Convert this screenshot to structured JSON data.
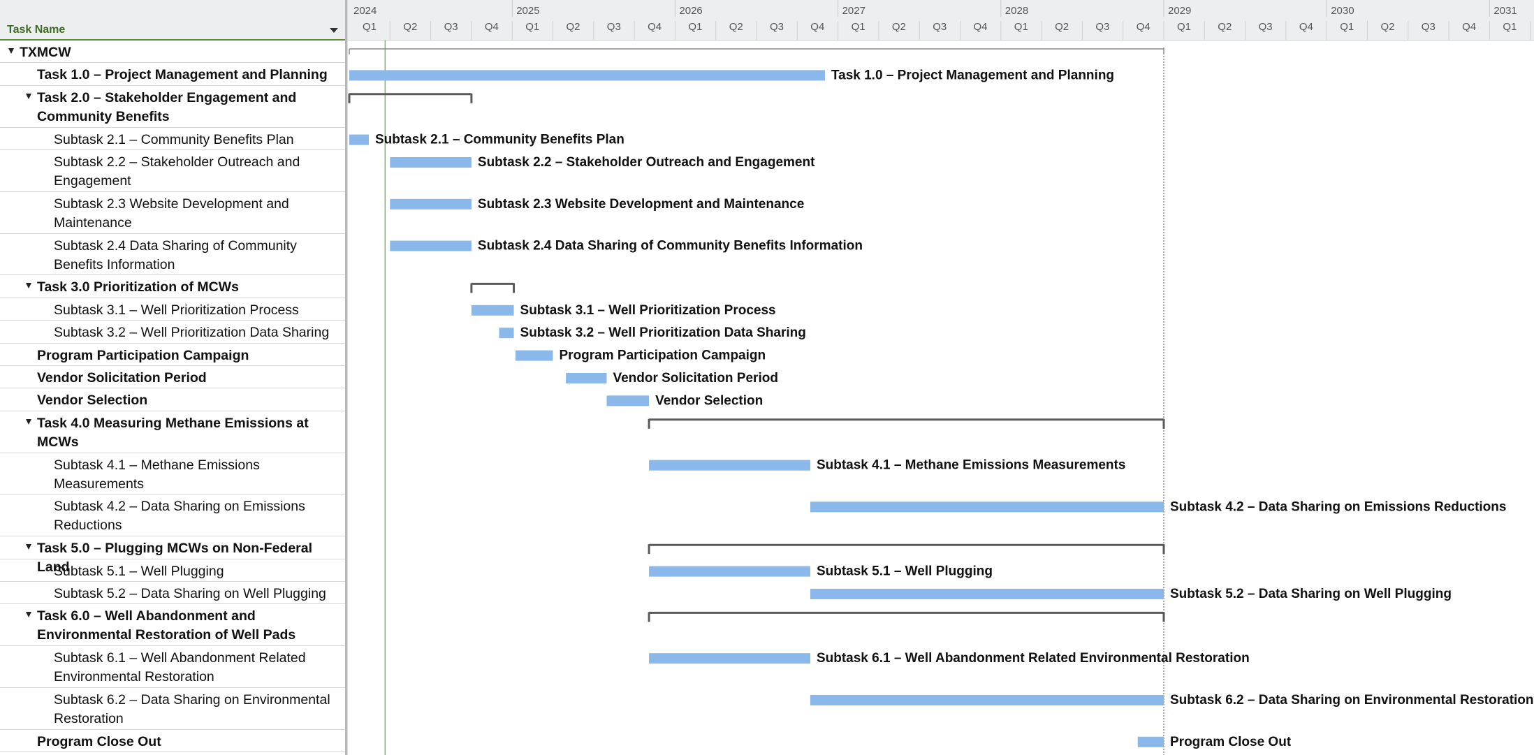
{
  "grid": {
    "header": "Task Name",
    "rows": [
      {
        "name": "TXMCW",
        "level": 0,
        "collapse": true,
        "lines": 1
      },
      {
        "name": "Task 1.0 – Project Management and Planning",
        "level": 1,
        "collapse": false,
        "lines": 1
      },
      {
        "name": "Task 2.0 – Stakeholder Engagement and Community Benefits",
        "level": 1,
        "collapse": true,
        "lines": 2,
        "line1": "Task 2.0 – Stakeholder Engagement and",
        "line2": "Community Benefits"
      },
      {
        "name": "Subtask 2.1 – Community Benefits Plan",
        "level": 2,
        "collapse": false,
        "lines": 1
      },
      {
        "name": "Subtask 2.2 – Stakeholder Outreach and Engagement",
        "level": 2,
        "collapse": false,
        "lines": 2,
        "line1": "Subtask 2.2 – Stakeholder Outreach and",
        "line2": "Engagement"
      },
      {
        "name": "Subtask 2.3 Website Development and Maintenance",
        "level": 2,
        "collapse": false,
        "lines": 2,
        "line1": "Subtask 2.3 Website Development and",
        "line2": "Maintenance"
      },
      {
        "name": "Subtask 2.4 Data Sharing of Community Benefits Information",
        "level": 2,
        "collapse": false,
        "lines": 2,
        "line1": "Subtask 2.4 Data Sharing of Community",
        "line2": "Benefits Information"
      },
      {
        "name": "Task 3.0 Prioritization of MCWs",
        "level": 1,
        "collapse": true,
        "lines": 1
      },
      {
        "name": "Subtask 3.1 – Well Prioritization Process",
        "level": 2,
        "collapse": false,
        "lines": 1
      },
      {
        "name": "Subtask 3.2 – Well Prioritization Data Sharing",
        "level": 2,
        "collapse": false,
        "lines": 1
      },
      {
        "name": "Program Participation Campaign",
        "level": 1,
        "collapse": false,
        "lines": 1
      },
      {
        "name": "Vendor Solicitation Period",
        "level": 1,
        "collapse": false,
        "lines": 1
      },
      {
        "name": "Vendor Selection",
        "level": 1,
        "collapse": false,
        "lines": 1
      },
      {
        "name": "Task 4.0 Measuring Methane Emissions at MCWs",
        "level": 1,
        "collapse": true,
        "lines": 2,
        "line1": "Task 4.0 Measuring Methane Emissions at",
        "line2": "MCWs"
      },
      {
        "name": "Subtask 4.1 – Methane Emissions Measurements",
        "level": 2,
        "collapse": false,
        "lines": 2,
        "line1": "Subtask 4.1 – Methane Emissions",
        "line2": "Measurements"
      },
      {
        "name": "Subtask 4.2 – Data Sharing on Emissions Reductions",
        "level": 2,
        "collapse": false,
        "lines": 2,
        "line1": "Subtask 4.2 – Data Sharing on Emissions",
        "line2": "Reductions"
      },
      {
        "name": "Task 5.0 – Plugging MCWs on Non-Federal Land",
        "level": 1,
        "collapse": true,
        "lines": 1
      },
      {
        "name": "Subtask 5.1 – Well Plugging",
        "level": 2,
        "collapse": false,
        "lines": 1
      },
      {
        "name": "Subtask 5.2 – Data Sharing on Well Plugging",
        "level": 2,
        "collapse": false,
        "lines": 1
      },
      {
        "name": "Task 6.0 – Well Abandonment and Environmental Restoration of Well Pads",
        "level": 1,
        "collapse": true,
        "lines": 2,
        "line1": "Task 6.0 – Well Abandonment and",
        "line2": "Environmental Restoration of Well Pads"
      },
      {
        "name": "Subtask 6.1 – Well Abandonment Related Environmental Restoration",
        "level": 2,
        "collapse": false,
        "lines": 2,
        "line1": "Subtask 6.1 – Well Abandonment Related",
        "line2": "Environmental Restoration"
      },
      {
        "name": "Subtask 6.2 – Data Sharing on Environmental Restoration",
        "level": 2,
        "collapse": false,
        "lines": 2,
        "line1": "Subtask 6.2 – Data Sharing on Environmental",
        "line2": "Restoration"
      },
      {
        "name": "Program Close Out",
        "level": 1,
        "collapse": false,
        "lines": 1
      }
    ]
  },
  "chart_data": {
    "type": "gantt",
    "timescale": {
      "years": [
        "2024",
        "2025",
        "2026",
        "2027",
        "2028",
        "2029",
        "2030",
        "2031"
      ],
      "quarters": [
        "Q1",
        "Q2",
        "Q3",
        "Q4"
      ],
      "start": 2024.0,
      "end": 2031.2
    },
    "bar_color": "#8ab8ea",
    "summary_color": "#5a5a5a",
    "today_marker": 2024.22,
    "project_summary_end": 2029.0,
    "tasks": [
      {
        "row": 0,
        "kind": "project",
        "start": 2024.0,
        "end": 2029.0,
        "label": ""
      },
      {
        "row": 1,
        "kind": "bar",
        "start": 2024.0,
        "end": 2026.92,
        "label": "Task 1.0 – Project Management and Planning"
      },
      {
        "row": 2,
        "kind": "summary",
        "start": 2024.0,
        "end": 2024.75,
        "label": ""
      },
      {
        "row": 3,
        "kind": "bar",
        "start": 2024.0,
        "end": 2024.12,
        "label": "Subtask 2.1 – Community Benefits Plan"
      },
      {
        "row": 4,
        "kind": "bar",
        "start": 2024.25,
        "end": 2024.75,
        "label": "Subtask 2.2 – Stakeholder Outreach and Engagement"
      },
      {
        "row": 5,
        "kind": "bar",
        "start": 2024.25,
        "end": 2024.75,
        "label": "Subtask 2.3 Website Development and Maintenance"
      },
      {
        "row": 6,
        "kind": "bar",
        "start": 2024.25,
        "end": 2024.75,
        "label": "Subtask 2.4 Data Sharing of Community Benefits Information"
      },
      {
        "row": 7,
        "kind": "summary",
        "start": 2024.75,
        "end": 2025.01,
        "label": ""
      },
      {
        "row": 8,
        "kind": "bar",
        "start": 2024.75,
        "end": 2025.01,
        "label": "Subtask 3.1 – Well Prioritization Process"
      },
      {
        "row": 9,
        "kind": "bar",
        "start": 2024.92,
        "end": 2025.01,
        "label": "Subtask 3.2 – Well Prioritization Data Sharing"
      },
      {
        "row": 10,
        "kind": "bar",
        "start": 2025.02,
        "end": 2025.25,
        "label": "Program Participation Campaign"
      },
      {
        "row": 11,
        "kind": "bar",
        "start": 2025.33,
        "end": 2025.58,
        "label": "Vendor Solicitation Period"
      },
      {
        "row": 12,
        "kind": "bar",
        "start": 2025.58,
        "end": 2025.84,
        "label": "Vendor Selection"
      },
      {
        "row": 13,
        "kind": "summary",
        "start": 2025.84,
        "end": 2029.0,
        "label": ""
      },
      {
        "row": 14,
        "kind": "bar",
        "start": 2025.84,
        "end": 2026.83,
        "label": "Subtask 4.1 – Methane Emissions Measurements"
      },
      {
        "row": 15,
        "kind": "bar",
        "start": 2026.83,
        "end": 2029.0,
        "label": "Subtask 4.2 – Data Sharing on Emissions Reductions"
      },
      {
        "row": 16,
        "kind": "summary",
        "start": 2025.84,
        "end": 2029.0,
        "label": ""
      },
      {
        "row": 17,
        "kind": "bar",
        "start": 2025.84,
        "end": 2026.83,
        "label": "Subtask 5.1 – Well Plugging"
      },
      {
        "row": 18,
        "kind": "bar",
        "start": 2026.83,
        "end": 2029.0,
        "label": "Subtask 5.2 – Data Sharing on Well Plugging"
      },
      {
        "row": 19,
        "kind": "summary",
        "start": 2025.84,
        "end": 2029.0,
        "label": ""
      },
      {
        "row": 20,
        "kind": "bar",
        "start": 2025.84,
        "end": 2026.83,
        "label": "Subtask 6.1 – Well Abandonment Related Environmental Restoration"
      },
      {
        "row": 21,
        "kind": "bar",
        "start": 2026.83,
        "end": 2029.0,
        "label": "Subtask 6.2 – Data Sharing on Environmental Restoration"
      },
      {
        "row": 22,
        "kind": "bar",
        "start": 2028.84,
        "end": 2029.0,
        "label": "Program Close Out"
      }
    ]
  }
}
